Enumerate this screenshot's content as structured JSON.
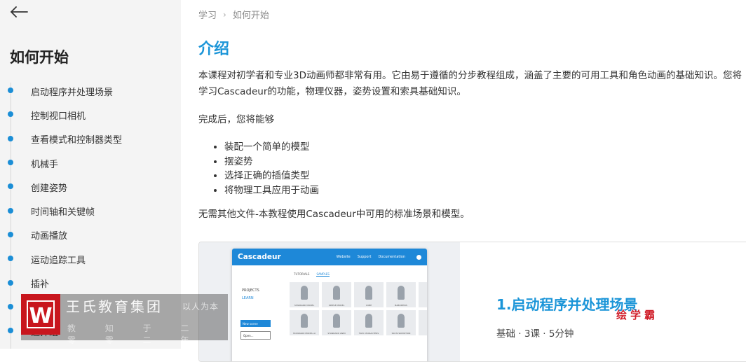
{
  "sidebar": {
    "title": "如何开始",
    "items": [
      {
        "label": "启动程序并处理场景"
      },
      {
        "label": "控制视口相机"
      },
      {
        "label": "查看模式和控制器类型"
      },
      {
        "label": "机械手"
      },
      {
        "label": "创建姿势"
      },
      {
        "label": "时间轴和关键帧"
      },
      {
        "label": "动画播放"
      },
      {
        "label": "运动追踪工具"
      },
      {
        "label": "插补"
      },
      {
        "label": "选择"
      },
      {
        "label": "选择组"
      }
    ]
  },
  "breadcrumb": {
    "root": "学习",
    "separator": "›",
    "current": "如何开始"
  },
  "main": {
    "title": "介绍",
    "paragraph1": "本课程对初学者和专业3D动画师都非常有用。它由易于遵循的分步教程组成，涵盖了主要的可用工具和角色动画的基础知识。您将学习Cascadeur的功能，物理仪器，姿势设置和索具基础知识。",
    "paragraph2": "完成后，您将能够",
    "bullets": [
      "装配一个简单的模型",
      "摆姿势",
      "选择正确的插值类型",
      "将物理工具应用于动画"
    ],
    "paragraph3": "无需其他文件-本教程使用Cascadeur中可用的标准场景和模型。"
  },
  "lesson_card": {
    "title": "1.启动程序并处理场景",
    "meta": "基础 · 3课 · 5分钟",
    "thumbnail": {
      "logo": "Cascadeur",
      "nav": [
        "Website",
        "Support",
        "Documentation"
      ],
      "tabs": [
        "TUTORIALS",
        "SAMPLES"
      ],
      "side": [
        "PROJECTS",
        "LEARN"
      ],
      "new_button": "New scene",
      "open_button": "Open...",
      "captions": [
        "STANDARD MODEL",
        "SIMPLE MODEL",
        "CUBE",
        "BABOPIPSIS",
        "",
        "STANDARD MODEL AI",
        "STANDARD ANIM",
        "TWO CHARACTERS",
        "SKI IN SKIMOTION",
        ""
      ]
    }
  },
  "watermark": {
    "brand": "王氏教育集团",
    "slogan": "以人为本",
    "sub": "教 知 于 二 零 零 二 年",
    "logo_letter": "W",
    "corner": "绘学霸"
  },
  "colors": {
    "accent": "#1b95d8",
    "dot": "#1b8ed6",
    "watermark_red": "#c8161d"
  },
  "icons": {
    "back": "arrow-left-icon",
    "toc_dot": "bullet-dot-icon"
  }
}
